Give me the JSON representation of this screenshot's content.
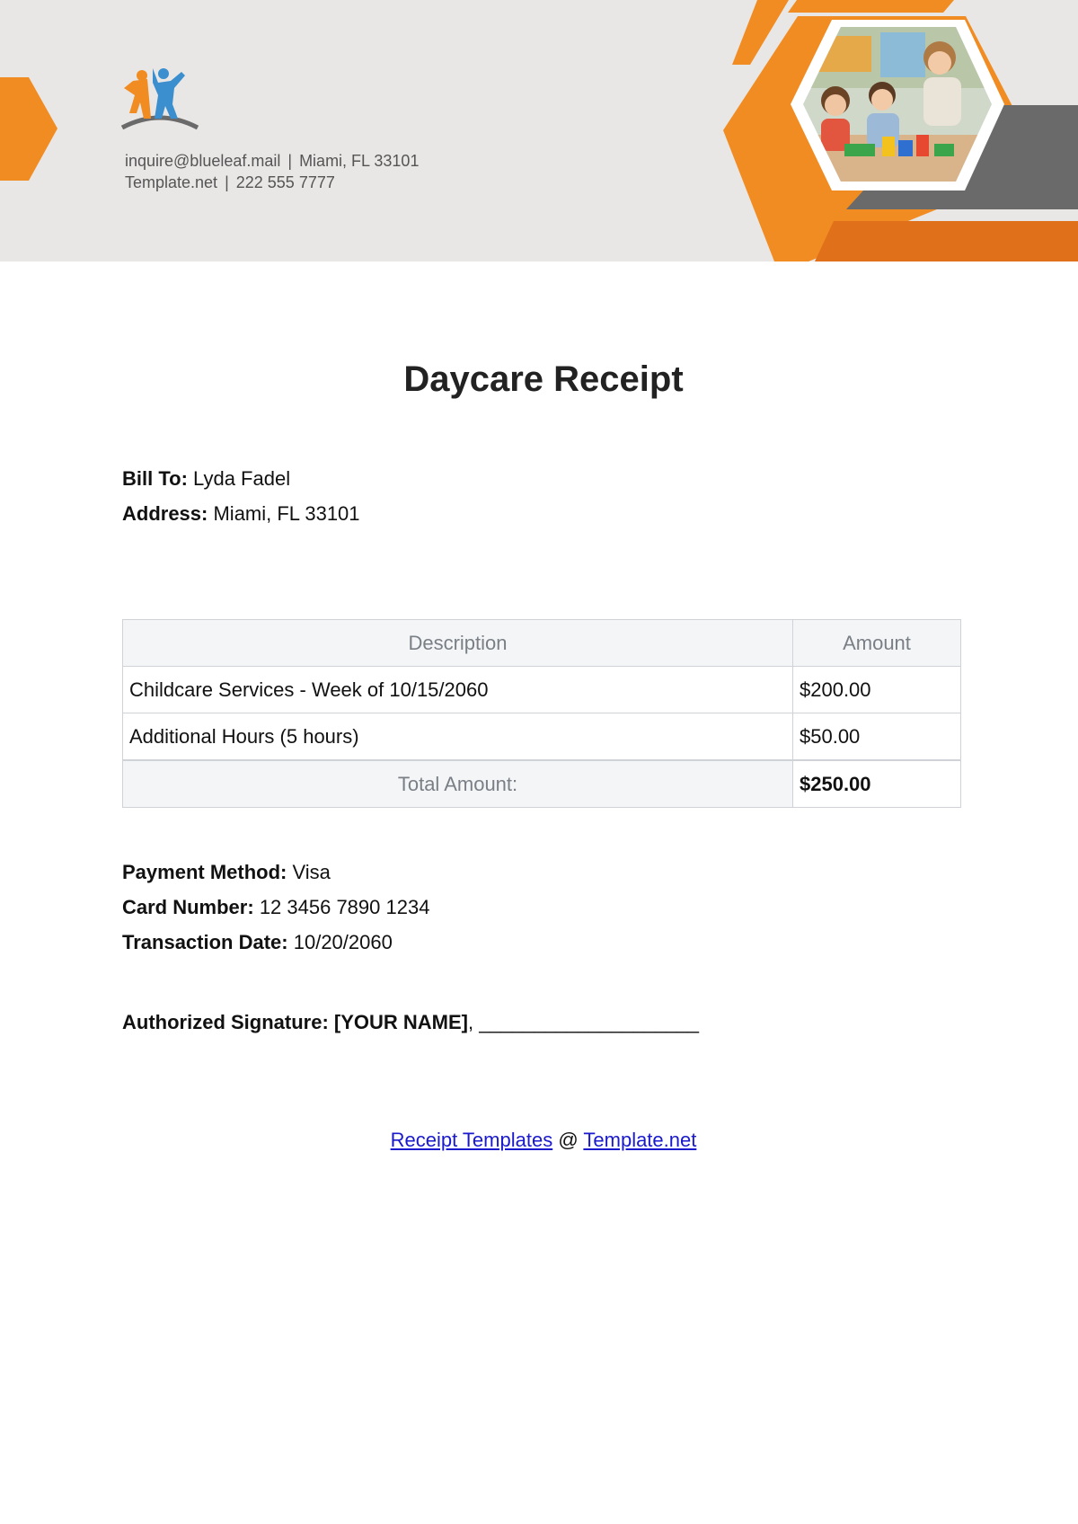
{
  "header": {
    "email": "inquire@blueleaf.mail",
    "location": "Miami, FL 33101",
    "website": "Template.net",
    "phone": "222 555 7777",
    "separator": "|",
    "colors": {
      "orange": "#f08c22",
      "dark_orange": "#e0711a",
      "gray": "#6a6a6a",
      "blue": "#3b8fcf",
      "background": "#e9e7e5"
    }
  },
  "title": "Daycare Receipt",
  "bill": {
    "bill_to_label": "Bill To:",
    "bill_to_value": "Lyda Fadel",
    "address_label": "Address:",
    "address_value": "Miami, FL 33101"
  },
  "table": {
    "headers": [
      "Description",
      "Amount"
    ],
    "rows": [
      {
        "description": "Childcare Services - Week of 10/15/2060",
        "amount": "$200.00"
      },
      {
        "description": "Additional Hours (5 hours)",
        "amount": "$50.00"
      }
    ],
    "total_label": "Total Amount:",
    "total_value": "$250.00"
  },
  "payment": {
    "method_label": "Payment Method:",
    "method_value": "Visa",
    "card_label": "Card Number:",
    "card_value": "12 3456 7890 1234",
    "date_label": "Transaction Date:",
    "date_value": "10/20/2060"
  },
  "signature": {
    "label": "Authorized Signature: [YOUR NAME]",
    "line": ", ____________________"
  },
  "footer": {
    "link1": "Receipt Templates",
    "at": "@",
    "link2": "Template.net"
  }
}
